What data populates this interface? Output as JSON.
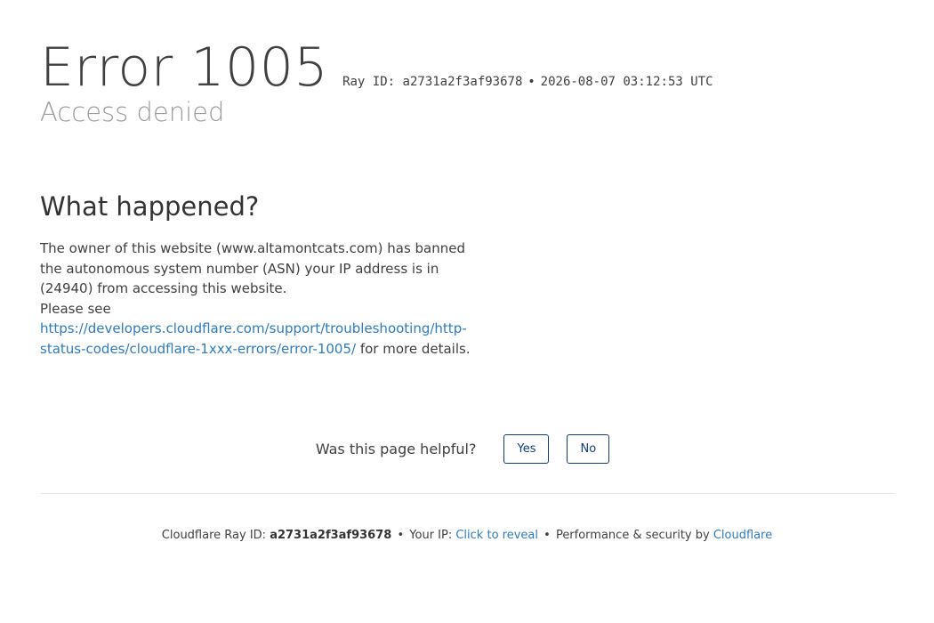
{
  "header": {
    "error_code": "Error 1005",
    "ray_label": "Ray ID:",
    "ray_id": "a2731a2f3af93678",
    "separator": "•",
    "timestamp": "2026-08-07 03:12:53 UTC",
    "subtitle": "Access denied"
  },
  "what_happened": {
    "heading": "What happened?",
    "text": "The owner of this website (www.altamontcats.com) has banned the autonomous system number (ASN) your IP address is in (24940) from accessing this website.",
    "please_see": "Please see",
    "link_text": "https://developers.cloudflare.com/support/troubleshooting/http-status-codes/cloudflare-1xxx-errors/error-1005/",
    "after_link": " for more details."
  },
  "feedback": {
    "question": "Was this page helpful?",
    "yes_label": "Yes",
    "no_label": "No"
  },
  "footer": {
    "ray_label": "Cloudflare Ray ID:",
    "ray_id": "a2731a2f3af93678",
    "separator": "•",
    "ip_label": "Your IP:",
    "ip_link": "Click to reveal",
    "perf_label": "Performance & security by",
    "brand_link": "Cloudflare"
  },
  "colors": {
    "link": "#2f7bbf",
    "button_border": "#0f3d7c",
    "subtitle": "#9b9b9b"
  }
}
